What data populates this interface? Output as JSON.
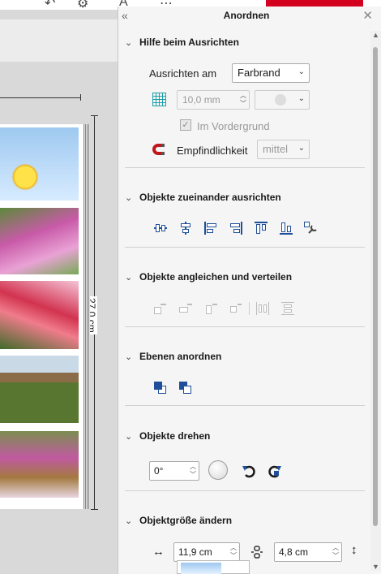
{
  "panel": {
    "title": "Anordnen",
    "collapse_icon": "double-chevron-left",
    "close_icon": "close"
  },
  "align_help": {
    "header": "Hilfe beim Ausrichten",
    "align_label": "Ausrichten am",
    "align_value": "Farbrand",
    "grid_value": "10,0 mm",
    "foreground_label": "Im Vordergrund",
    "foreground_checked": true,
    "sensitivity_label": "Empfindlichkeit",
    "sensitivity_value": "mittel"
  },
  "align_objects": {
    "header": "Objekte zueinander ausrichten"
  },
  "match_distribute": {
    "header": "Objekte angleichen und verteilen"
  },
  "layers": {
    "header": "Ebenen anordnen"
  },
  "rotate": {
    "header": "Objekte drehen",
    "angle_value": "0°"
  },
  "resize": {
    "header": "Objektgröße ändern",
    "width_value": "11,9 cm",
    "height_value": "4,8 cm"
  },
  "canvas": {
    "height_label": "27,0 cm"
  },
  "colors": {
    "accent": "#1f4f9a",
    "brand_red": "#d2001e",
    "magnet_red": "#c0161e"
  }
}
